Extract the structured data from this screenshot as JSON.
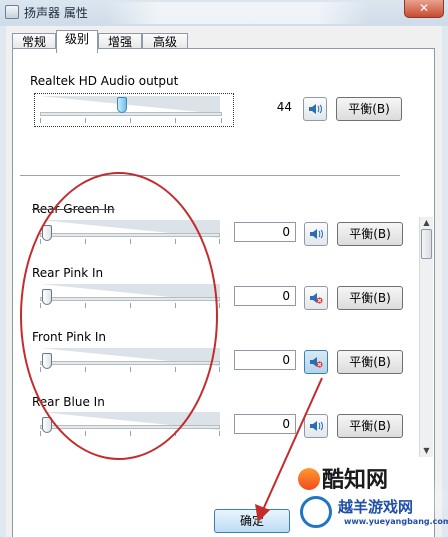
{
  "window": {
    "title": "扬声器 属性",
    "close_glyph": "✕"
  },
  "tabs": [
    {
      "label": "常规",
      "active": false
    },
    {
      "label": "级别",
      "active": true
    },
    {
      "label": "增强",
      "active": false
    },
    {
      "label": "高级",
      "active": false
    }
  ],
  "main_output": {
    "label": "Realtek HD Audio output",
    "level": "44",
    "slider_level": 44,
    "muted": false,
    "balance_label": "平衡(B)"
  },
  "inputs": [
    {
      "label": "Rear Green In",
      "level": "0",
      "muted": false,
      "balance_label": "平衡(B)"
    },
    {
      "label": "Rear Pink In",
      "level": "0",
      "muted": true,
      "balance_label": "平衡(B)"
    },
    {
      "label": "Front Pink In",
      "level": "0",
      "muted": true,
      "balance_label": "平衡(B)"
    },
    {
      "label": "Rear Blue In",
      "level": "0",
      "muted": false,
      "balance_label": "平衡(B)"
    }
  ],
  "buttons": {
    "ok_label": "确定"
  },
  "watermark": {
    "brand": "酷知网",
    "site_name": "越羊游戏网",
    "url": "www.yueyangbang.com"
  },
  "annotation_color": "#c42c2c"
}
